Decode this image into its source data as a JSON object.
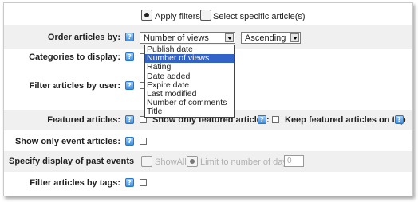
{
  "filter_mode": {
    "apply_label": "Apply filters",
    "specific_label": "Select specific article(s)",
    "selected": "apply"
  },
  "order": {
    "label": "Order articles by:",
    "selected": "Number of views",
    "direction": "Ascending",
    "options": [
      "Publish date",
      "Number of views",
      "Rating",
      "Date added",
      "Expire date",
      "Last modified",
      "Number of comments",
      "Title"
    ]
  },
  "categories": {
    "label": "Categories to display:"
  },
  "filter_user": {
    "label": "Filter articles by user:"
  },
  "featured": {
    "label": "Featured articles:",
    "only_label": "Show only featured articles:",
    "keep_top_label": "Keep featured articles on top"
  },
  "events": {
    "label": "Show only event articles:"
  },
  "past_events": {
    "label": "Specify display of past events",
    "show_all_label": "ShowAll",
    "limit_label": "Limit to number of days:",
    "days_value": "0"
  },
  "tags": {
    "label": "Filter articles by tags:"
  },
  "help_glyph": "?"
}
